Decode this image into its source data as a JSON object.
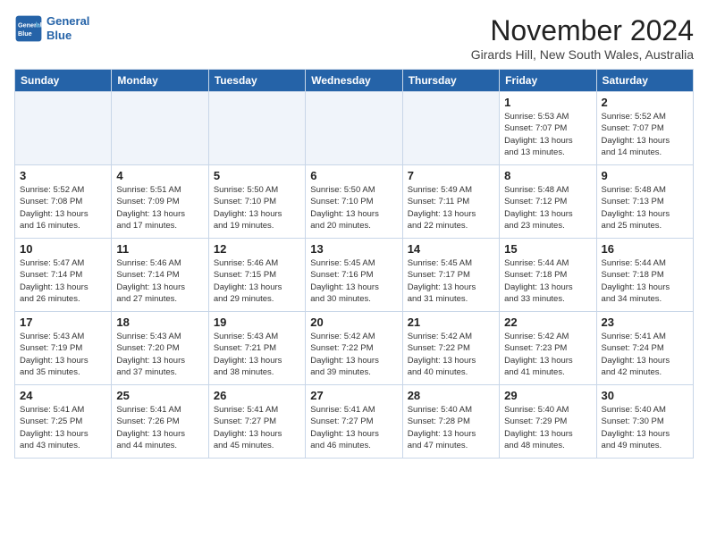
{
  "header": {
    "logo_line1": "General",
    "logo_line2": "Blue",
    "month": "November 2024",
    "location": "Girards Hill, New South Wales, Australia"
  },
  "weekdays": [
    "Sunday",
    "Monday",
    "Tuesday",
    "Wednesday",
    "Thursday",
    "Friday",
    "Saturday"
  ],
  "weeks": [
    [
      {
        "day": "",
        "detail": ""
      },
      {
        "day": "",
        "detail": ""
      },
      {
        "day": "",
        "detail": ""
      },
      {
        "day": "",
        "detail": ""
      },
      {
        "day": "",
        "detail": ""
      },
      {
        "day": "1",
        "detail": "Sunrise: 5:53 AM\nSunset: 7:07 PM\nDaylight: 13 hours\nand 13 minutes."
      },
      {
        "day": "2",
        "detail": "Sunrise: 5:52 AM\nSunset: 7:07 PM\nDaylight: 13 hours\nand 14 minutes."
      }
    ],
    [
      {
        "day": "3",
        "detail": "Sunrise: 5:52 AM\nSunset: 7:08 PM\nDaylight: 13 hours\nand 16 minutes."
      },
      {
        "day": "4",
        "detail": "Sunrise: 5:51 AM\nSunset: 7:09 PM\nDaylight: 13 hours\nand 17 minutes."
      },
      {
        "day": "5",
        "detail": "Sunrise: 5:50 AM\nSunset: 7:10 PM\nDaylight: 13 hours\nand 19 minutes."
      },
      {
        "day": "6",
        "detail": "Sunrise: 5:50 AM\nSunset: 7:10 PM\nDaylight: 13 hours\nand 20 minutes."
      },
      {
        "day": "7",
        "detail": "Sunrise: 5:49 AM\nSunset: 7:11 PM\nDaylight: 13 hours\nand 22 minutes."
      },
      {
        "day": "8",
        "detail": "Sunrise: 5:48 AM\nSunset: 7:12 PM\nDaylight: 13 hours\nand 23 minutes."
      },
      {
        "day": "9",
        "detail": "Sunrise: 5:48 AM\nSunset: 7:13 PM\nDaylight: 13 hours\nand 25 minutes."
      }
    ],
    [
      {
        "day": "10",
        "detail": "Sunrise: 5:47 AM\nSunset: 7:14 PM\nDaylight: 13 hours\nand 26 minutes."
      },
      {
        "day": "11",
        "detail": "Sunrise: 5:46 AM\nSunset: 7:14 PM\nDaylight: 13 hours\nand 27 minutes."
      },
      {
        "day": "12",
        "detail": "Sunrise: 5:46 AM\nSunset: 7:15 PM\nDaylight: 13 hours\nand 29 minutes."
      },
      {
        "day": "13",
        "detail": "Sunrise: 5:45 AM\nSunset: 7:16 PM\nDaylight: 13 hours\nand 30 minutes."
      },
      {
        "day": "14",
        "detail": "Sunrise: 5:45 AM\nSunset: 7:17 PM\nDaylight: 13 hours\nand 31 minutes."
      },
      {
        "day": "15",
        "detail": "Sunrise: 5:44 AM\nSunset: 7:18 PM\nDaylight: 13 hours\nand 33 minutes."
      },
      {
        "day": "16",
        "detail": "Sunrise: 5:44 AM\nSunset: 7:18 PM\nDaylight: 13 hours\nand 34 minutes."
      }
    ],
    [
      {
        "day": "17",
        "detail": "Sunrise: 5:43 AM\nSunset: 7:19 PM\nDaylight: 13 hours\nand 35 minutes."
      },
      {
        "day": "18",
        "detail": "Sunrise: 5:43 AM\nSunset: 7:20 PM\nDaylight: 13 hours\nand 37 minutes."
      },
      {
        "day": "19",
        "detail": "Sunrise: 5:43 AM\nSunset: 7:21 PM\nDaylight: 13 hours\nand 38 minutes."
      },
      {
        "day": "20",
        "detail": "Sunrise: 5:42 AM\nSunset: 7:22 PM\nDaylight: 13 hours\nand 39 minutes."
      },
      {
        "day": "21",
        "detail": "Sunrise: 5:42 AM\nSunset: 7:22 PM\nDaylight: 13 hours\nand 40 minutes."
      },
      {
        "day": "22",
        "detail": "Sunrise: 5:42 AM\nSunset: 7:23 PM\nDaylight: 13 hours\nand 41 minutes."
      },
      {
        "day": "23",
        "detail": "Sunrise: 5:41 AM\nSunset: 7:24 PM\nDaylight: 13 hours\nand 42 minutes."
      }
    ],
    [
      {
        "day": "24",
        "detail": "Sunrise: 5:41 AM\nSunset: 7:25 PM\nDaylight: 13 hours\nand 43 minutes."
      },
      {
        "day": "25",
        "detail": "Sunrise: 5:41 AM\nSunset: 7:26 PM\nDaylight: 13 hours\nand 44 minutes."
      },
      {
        "day": "26",
        "detail": "Sunrise: 5:41 AM\nSunset: 7:27 PM\nDaylight: 13 hours\nand 45 minutes."
      },
      {
        "day": "27",
        "detail": "Sunrise: 5:41 AM\nSunset: 7:27 PM\nDaylight: 13 hours\nand 46 minutes."
      },
      {
        "day": "28",
        "detail": "Sunrise: 5:40 AM\nSunset: 7:28 PM\nDaylight: 13 hours\nand 47 minutes."
      },
      {
        "day": "29",
        "detail": "Sunrise: 5:40 AM\nSunset: 7:29 PM\nDaylight: 13 hours\nand 48 minutes."
      },
      {
        "day": "30",
        "detail": "Sunrise: 5:40 AM\nSunset: 7:30 PM\nDaylight: 13 hours\nand 49 minutes."
      }
    ]
  ]
}
